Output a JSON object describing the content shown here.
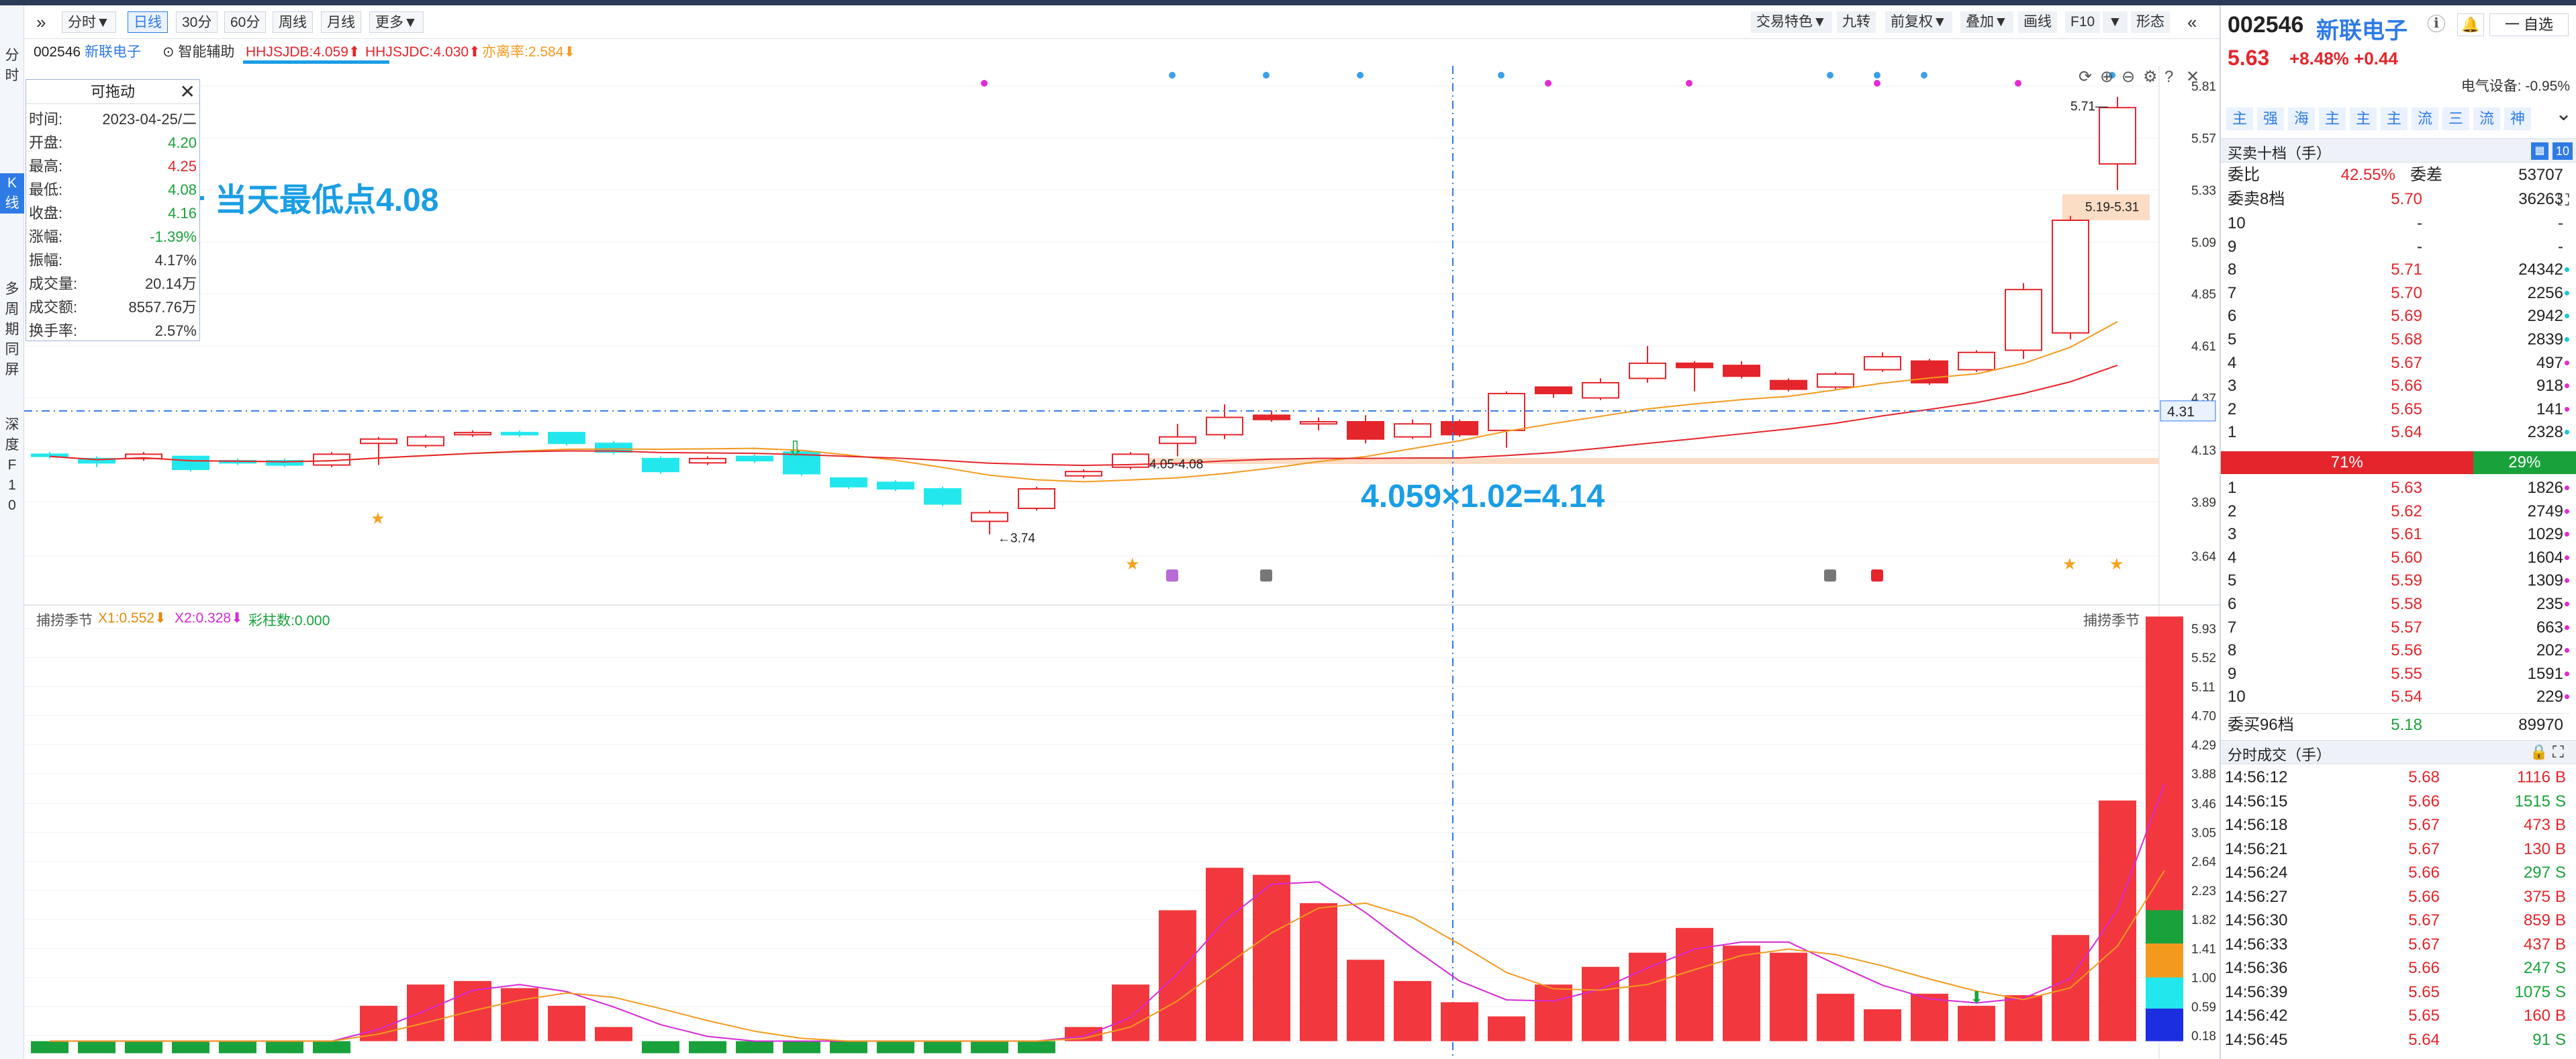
{
  "left_sidebar": {
    "items": [
      {
        "label": "分\n时"
      },
      {
        "label": "K\n线"
      },
      {
        "label": "多\n周\n期\n同\n屏"
      },
      {
        "label": "深\n度\nF\n1\n0"
      }
    ]
  },
  "toolbar": {
    "collapse_icon": "»",
    "periods": [
      {
        "label": "分时▼"
      },
      {
        "label": "日线"
      },
      {
        "label": "30分"
      },
      {
        "label": "60分"
      },
      {
        "label": "周线"
      },
      {
        "label": "月线"
      },
      {
        "label": "更多▼"
      }
    ],
    "right_tools": [
      {
        "label": "交易特色▼"
      },
      {
        "label": "九转"
      },
      {
        "label": "前复权▼"
      },
      {
        "label": "叠加▼"
      },
      {
        "label": "画线"
      },
      {
        "label": "F10"
      },
      {
        "label": "▼"
      },
      {
        "label": "形态"
      },
      {
        "label": "«"
      }
    ]
  },
  "infobar": {
    "code": "002546",
    "name": "新联电子",
    "assist": "⊙ 智能辅助",
    "ind1": "HHJSJDB:4.059⬆",
    "ind2": "HHJSJDC:4.030⬆",
    "ind3": "亦离率:2.584⬇"
  },
  "popup": {
    "title": "可拖动",
    "close": "✕",
    "rows": [
      {
        "k": "时间:",
        "v": "2023-04-25/二",
        "c": "#333"
      },
      {
        "k": "开盘:",
        "v": "4.20",
        "c": "#19a23b"
      },
      {
        "k": "最高:",
        "v": "4.25",
        "c": "#e4252b"
      },
      {
        "k": "最低:",
        "v": "4.08",
        "c": "#19a23b"
      },
      {
        "k": "收盘:",
        "v": "4.16",
        "c": "#19a23b"
      },
      {
        "k": "涨幅:",
        "v": "-1.39%",
        "c": "#19a23b"
      },
      {
        "k": "振幅:",
        "v": "4.17%",
        "c": "#333"
      },
      {
        "k": "成交量:",
        "v": "20.14万",
        "c": "#333"
      },
      {
        "k": "成交额:",
        "v": "8557.76万",
        "c": "#333"
      },
      {
        "k": "换手率:",
        "v": "2.57%",
        "c": "#333"
      }
    ]
  },
  "annotations": {
    "low_point": "当天最低点4.08",
    "formula": "4.059×1.02=4.14"
  },
  "main_chart": {
    "yticks": [
      "5.81",
      "5.57",
      "5.33",
      "5.09",
      "4.85",
      "4.61",
      "4.37",
      "4.13",
      "3.89",
      "3.64"
    ],
    "crosshair_price": "4.31",
    "labels": {
      "high": "5.71",
      "band": "5.19-5.31",
      "low1": "3.74",
      "low2": "4.05-4.08"
    },
    "icons": [
      "refresh-icon",
      "plus-icon",
      "minus-icon",
      "settings-icon",
      "help-icon",
      "close-icon"
    ]
  },
  "sub_chart": {
    "title": "捕捞季节",
    "x1": "X1:0.552⬇",
    "x2": "X2:0.328⬇",
    "bar": "彩柱数:0.000",
    "right_title": "捕捞季节",
    "yticks": [
      "5.93",
      "5.52",
      "5.11",
      "4.70",
      "4.29",
      "3.88",
      "3.46",
      "3.05",
      "2.64",
      "2.23",
      "1.82",
      "1.41",
      "1.00",
      "0.59",
      "0.18"
    ]
  },
  "right_panel": {
    "code": "002546",
    "name": "新联电子",
    "info_icon": "ℹ",
    "watch": "一 自选",
    "price": "5.63",
    "change": "+8.48% +0.44",
    "sector": "电气设备: -0.95%",
    "tags": [
      "主",
      "强",
      "海",
      "主",
      "主",
      "主",
      "流",
      "三",
      "流",
      "神"
    ],
    "orderbook_title": "买卖十档（手）",
    "ob_level": "10",
    "weibi_label": "委比",
    "weibi": "42.55%",
    "weicha_label": "委差",
    "weicha": "53707",
    "sell_total_label": "委卖8档",
    "sell_total_price": "5.70",
    "sell_total_vol": "36263",
    "sells": [
      {
        "lvl": "10",
        "price": "-",
        "vol": "-",
        "dot": ""
      },
      {
        "lvl": "9",
        "price": "-",
        "vol": "-",
        "dot": ""
      },
      {
        "lvl": "8",
        "price": "5.71",
        "vol": "24342",
        "dot": "#19c8d6"
      },
      {
        "lvl": "7",
        "price": "5.70",
        "vol": "2256",
        "dot": "#19c8d6"
      },
      {
        "lvl": "6",
        "price": "5.69",
        "vol": "2942",
        "dot": "#19c8d6"
      },
      {
        "lvl": "5",
        "price": "5.68",
        "vol": "2839",
        "dot": "#19c8d6"
      },
      {
        "lvl": "4",
        "price": "5.67",
        "vol": "497",
        "dot": "#e42ad3"
      },
      {
        "lvl": "3",
        "price": "5.66",
        "vol": "918",
        "dot": "#e42ad3"
      },
      {
        "lvl": "2",
        "price": "5.65",
        "vol": "141",
        "dot": "#e42ad3"
      },
      {
        "lvl": "1",
        "price": "5.64",
        "vol": "2328",
        "dot": "#19c8d6"
      }
    ],
    "ratio_buy": "71%",
    "ratio_sell": "29%",
    "buys": [
      {
        "lvl": "1",
        "price": "5.63",
        "vol": "1826",
        "dot": "#e42ad3"
      },
      {
        "lvl": "2",
        "price": "5.62",
        "vol": "2749",
        "dot": "#e42ad3"
      },
      {
        "lvl": "3",
        "price": "5.61",
        "vol": "1029",
        "dot": "#e42ad3"
      },
      {
        "lvl": "4",
        "price": "5.60",
        "vol": "1604",
        "dot": "#e42ad3"
      },
      {
        "lvl": "5",
        "price": "5.59",
        "vol": "1309",
        "dot": "#e42ad3"
      },
      {
        "lvl": "6",
        "price": "5.58",
        "vol": "235",
        "dot": "#e42ad3"
      },
      {
        "lvl": "7",
        "price": "5.57",
        "vol": "663",
        "dot": "#e42ad3"
      },
      {
        "lvl": "8",
        "price": "5.56",
        "vol": "202",
        "dot": "#e42ad3"
      },
      {
        "lvl": "9",
        "price": "5.55",
        "vol": "1591",
        "dot": "#e42ad3"
      },
      {
        "lvl": "10",
        "price": "5.54",
        "vol": "229",
        "dot": "#e42ad3"
      }
    ],
    "buy_total_label": "委买96档",
    "buy_total_price": "5.18",
    "buy_total_vol": "89970",
    "trades_title": "分时成交（手）",
    "trades": [
      {
        "t": "14:56:12",
        "p": "5.68",
        "q": "1116",
        "bs": "B"
      },
      {
        "t": "14:56:15",
        "p": "5.66",
        "q": "1515",
        "bs": "S"
      },
      {
        "t": "14:56:18",
        "p": "5.67",
        "q": "473",
        "bs": "B"
      },
      {
        "t": "14:56:21",
        "p": "5.67",
        "q": "130",
        "bs": "B"
      },
      {
        "t": "14:56:24",
        "p": "5.66",
        "q": "297",
        "bs": "S"
      },
      {
        "t": "14:56:27",
        "p": "5.66",
        "q": "375",
        "bs": "B"
      },
      {
        "t": "14:56:30",
        "p": "5.67",
        "q": "859",
        "bs": "B"
      },
      {
        "t": "14:56:33",
        "p": "5.67",
        "q": "437",
        "bs": "B"
      },
      {
        "t": "14:56:36",
        "p": "5.66",
        "q": "247",
        "bs": "S"
      },
      {
        "t": "14:56:39",
        "p": "5.65",
        "q": "1075",
        "bs": "S"
      },
      {
        "t": "14:56:42",
        "p": "5.65",
        "q": "160",
        "bs": "B"
      },
      {
        "t": "14:56:45",
        "p": "5.64",
        "q": "91",
        "bs": "S"
      }
    ]
  },
  "colors": {
    "up": "#e4252b",
    "down": "#19a23b",
    "cyan": "#22e8ee",
    "accent": "#2f7be5",
    "annot": "#1a9ee5"
  }
}
